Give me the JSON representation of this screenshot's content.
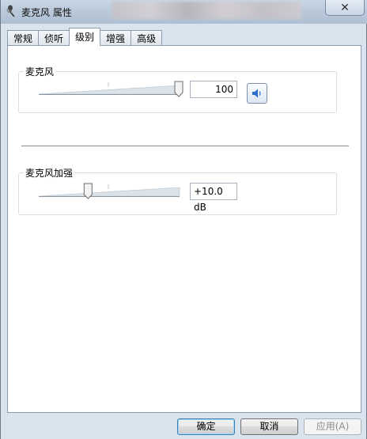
{
  "window": {
    "title": "麦克风 属性",
    "close_label": "✕"
  },
  "tabs": [
    {
      "label": "常规",
      "active": false
    },
    {
      "label": "侦听",
      "active": false
    },
    {
      "label": "级别",
      "active": true
    },
    {
      "label": "增强",
      "active": false
    },
    {
      "label": "高级",
      "active": false
    }
  ],
  "microphone": {
    "label": "麦克风",
    "level": 100,
    "level_max": 100,
    "value_text": "100",
    "mute_icon": "speaker-icon"
  },
  "boost": {
    "label": "麦克风加强",
    "level": 10,
    "level_max": 30,
    "value_text": "+10.0 dB"
  },
  "buttons": {
    "ok": "确定",
    "cancel": "取消",
    "apply": "应用(A)"
  },
  "colors": {
    "accent": "#3c7fb1",
    "speaker_blue": "#2a6fc9"
  }
}
